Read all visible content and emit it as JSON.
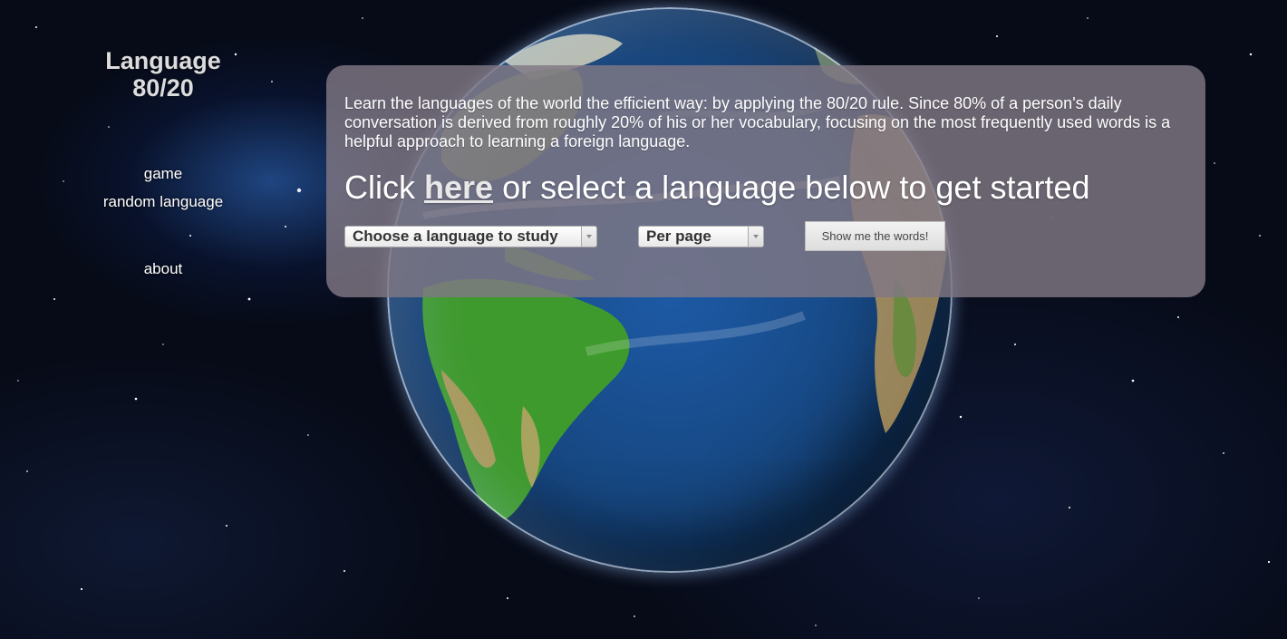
{
  "site": {
    "logo_line1": "Language",
    "logo_line2": "80/20"
  },
  "nav": {
    "game": "game",
    "random_language": "random language",
    "about": "about"
  },
  "panel": {
    "intro": "Learn the languages of the world the efficient way: by applying the 80/20 rule. Since 80% of a person's daily conversation is derived from roughly 20% of his or her vocabulary, focusing on the most frequently used words is a helpful approach to learning a foreign language.",
    "cta_prefix": "Click",
    "cta_link": "here",
    "cta_suffix": "or select a language below to get started"
  },
  "controls": {
    "language_select": "Choose a language to study",
    "per_page_select": "Per page",
    "submit_label": "Show me the words!"
  },
  "colors": {
    "panel_background": "#807884",
    "page_background": "#070b18"
  }
}
